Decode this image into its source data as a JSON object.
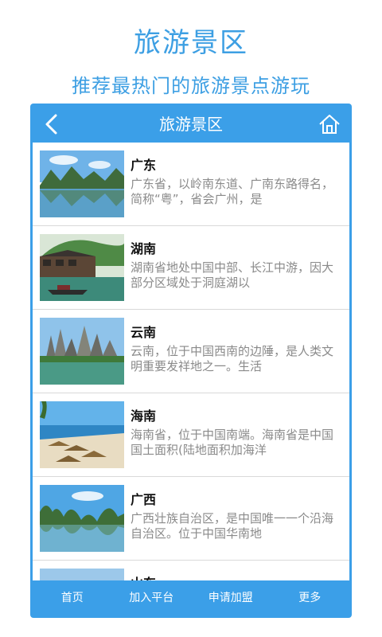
{
  "promo": {
    "title": "旅游景区",
    "subtitle": "推荐最热门的旅游景点游玩"
  },
  "nav": {
    "title": "旅游景区",
    "back_icon": "back-chevron-icon",
    "home_icon": "home-icon"
  },
  "colors": {
    "accent": "#3b9fe8",
    "promo_text": "#3d9fe3",
    "desc_text": "#8a8a8a"
  },
  "list": {
    "items": [
      {
        "name": "广东",
        "desc": "广东省，以岭南东道、广南东路得名，简称“粤”，省会广州，是"
      },
      {
        "name": "湖南",
        "desc": "湖南省地处中国中部、长江中游，因大部分区域处于洞庭湖以"
      },
      {
        "name": "云南",
        "desc": "云南，位于中国西南的边陲，是人类文明重要发祥地之一。生活"
      },
      {
        "name": "海南",
        "desc": "海南省，位于中国南端。海南省是中国国土面积(陆地面积加海洋"
      },
      {
        "name": "广西",
        "desc": "广西壮族自治区，是中国唯一一个沿海自治区。位于中国华南地"
      },
      {
        "name": "山东",
        "desc": ""
      }
    ]
  },
  "tabs": [
    {
      "label": "首页"
    },
    {
      "label": "加入平台"
    },
    {
      "label": "申请加盟"
    },
    {
      "label": "更多"
    }
  ]
}
